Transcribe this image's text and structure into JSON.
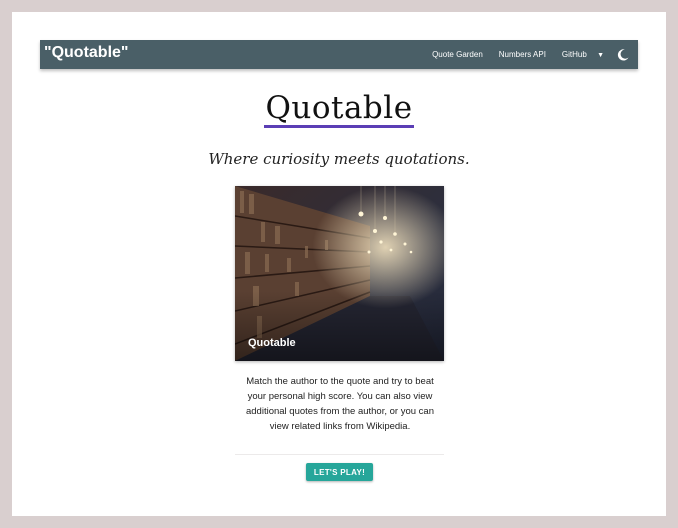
{
  "navbar": {
    "brand": "\"Quotable\"",
    "links": [
      "Quote Garden",
      "Numbers API",
      "GitHub"
    ]
  },
  "hero": {
    "title": "Quotable",
    "subtitle": "Where curiosity meets quotations."
  },
  "card": {
    "title": "Quotable",
    "description": "Match the author to the quote and try to beat your personal high score. You can also view additional quotes from the author, or you can view related links from Wikipedia."
  },
  "actions": {
    "play_label": "LET'S PLAY!"
  },
  "colors": {
    "navbar": "#4a5f67",
    "accent_button": "#26a69a",
    "title_underline": "#5b3eb5"
  }
}
